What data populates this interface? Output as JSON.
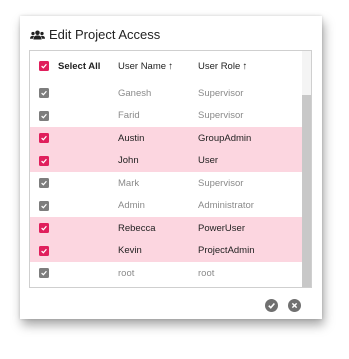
{
  "dialog": {
    "title": "Edit Project Access",
    "title_icon": "users-icon"
  },
  "header": {
    "select_all": "Select All",
    "user_name": "User Name",
    "user_role": "User Role",
    "sort_arrow": "↑"
  },
  "rows": [
    {
      "name": "Ganesh",
      "role": "Supervisor",
      "selected": false
    },
    {
      "name": "Farid",
      "role": "Supervisor",
      "selected": false
    },
    {
      "name": "Austin",
      "role": "GroupAdmin",
      "selected": true
    },
    {
      "name": "John",
      "role": "User",
      "selected": true
    },
    {
      "name": "Mark",
      "role": "Supervisor",
      "selected": false
    },
    {
      "name": "Admin",
      "role": "Administrator",
      "selected": false
    },
    {
      "name": "Rebecca",
      "role": "PowerUser",
      "selected": true
    },
    {
      "name": "Kevin",
      "role": "ProjectAdmin",
      "selected": true
    },
    {
      "name": "root",
      "role": "root",
      "selected": false
    }
  ],
  "footer": {
    "confirm_icon": "check-circle-icon",
    "cancel_icon": "close-circle-icon"
  },
  "colors": {
    "accent": "#e01f5c",
    "selected_row": "#fcd6e0",
    "disabled_check": "#7d7d7d"
  }
}
